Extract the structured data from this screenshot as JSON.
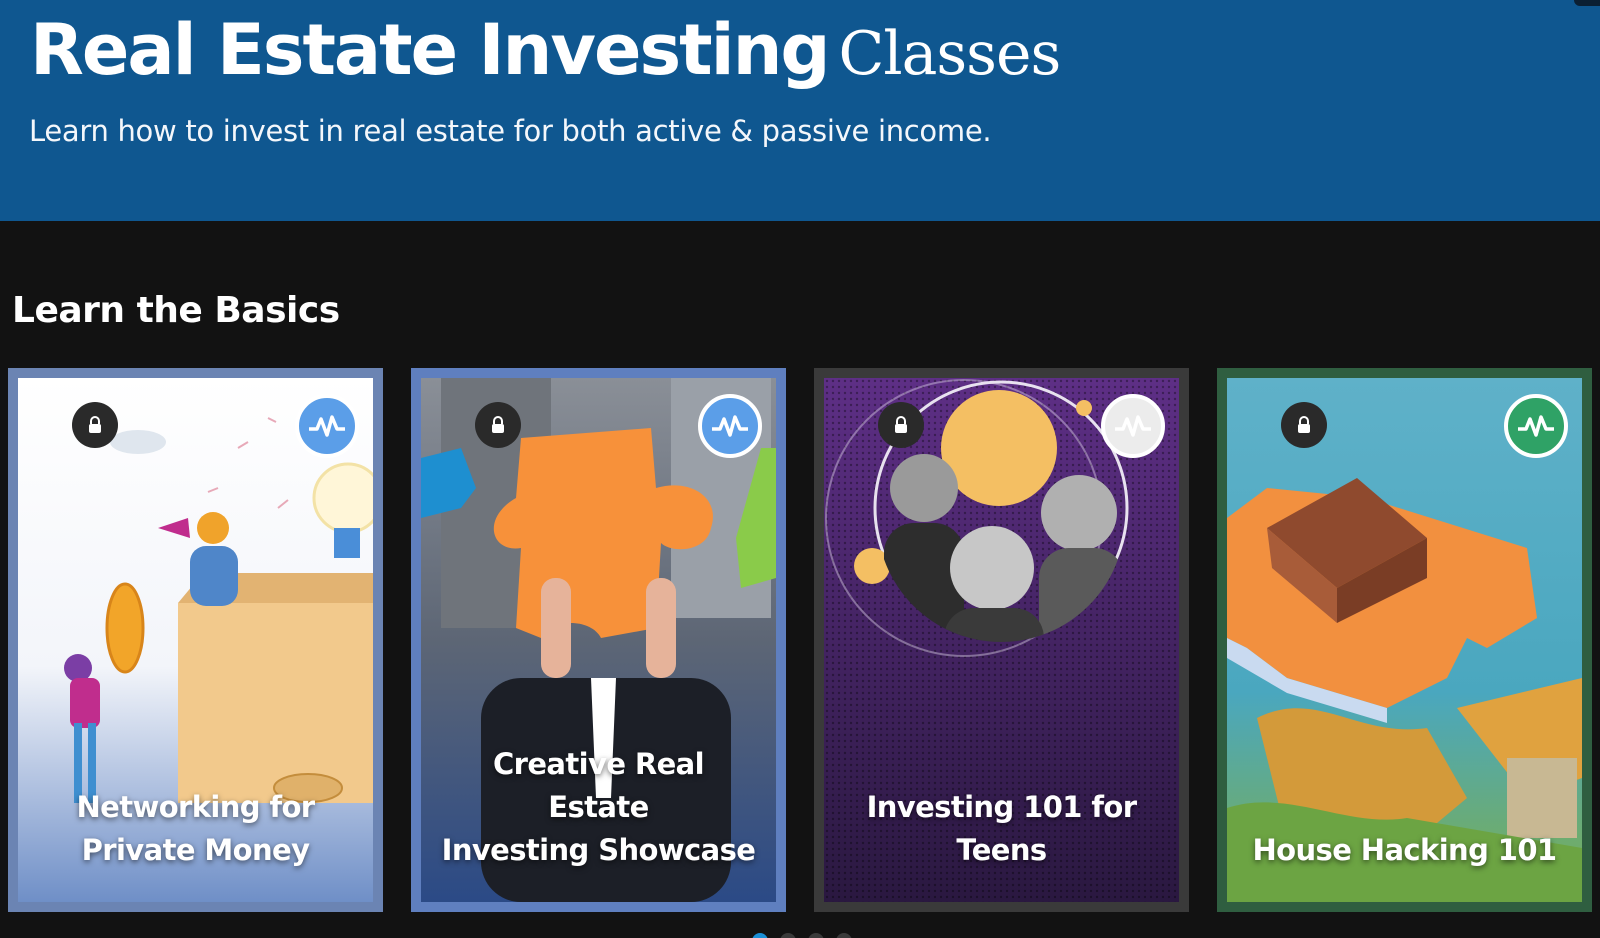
{
  "hero": {
    "title_bold": "Real Estate Investing",
    "title_serif": "Classes",
    "subtitle": "Learn how to invest in real estate for both active & passive income.",
    "background": "#0f5790"
  },
  "section": {
    "title": "Learn the Basics"
  },
  "cards": [
    {
      "title_line1": "Networking for",
      "title_line2": "Private Money",
      "locked": true,
      "badge_icon": "pulse-icon",
      "badge_color": "#5b9ee8",
      "border_color": "#6b84b3"
    },
    {
      "title_line1": "Creative Real Estate",
      "title_line2": "Investing Showcase",
      "locked": true,
      "badge_icon": "pulse-icon",
      "badge_color": "#5b9ee8",
      "border_color": "#5f7fbf"
    },
    {
      "title_line1": "Investing 101 for",
      "title_line2": "Teens",
      "locked": true,
      "badge_icon": "pulse-icon",
      "badge_color": "#ececec",
      "border_color": "#3a3a3a"
    },
    {
      "title_line1": "",
      "title_line2": "House Hacking 101",
      "locked": true,
      "badge_icon": "pulse-icon",
      "badge_color": "#2fa266",
      "border_color": "#2f5e40"
    }
  ],
  "carousel": {
    "active_index": 1,
    "count": 4
  }
}
